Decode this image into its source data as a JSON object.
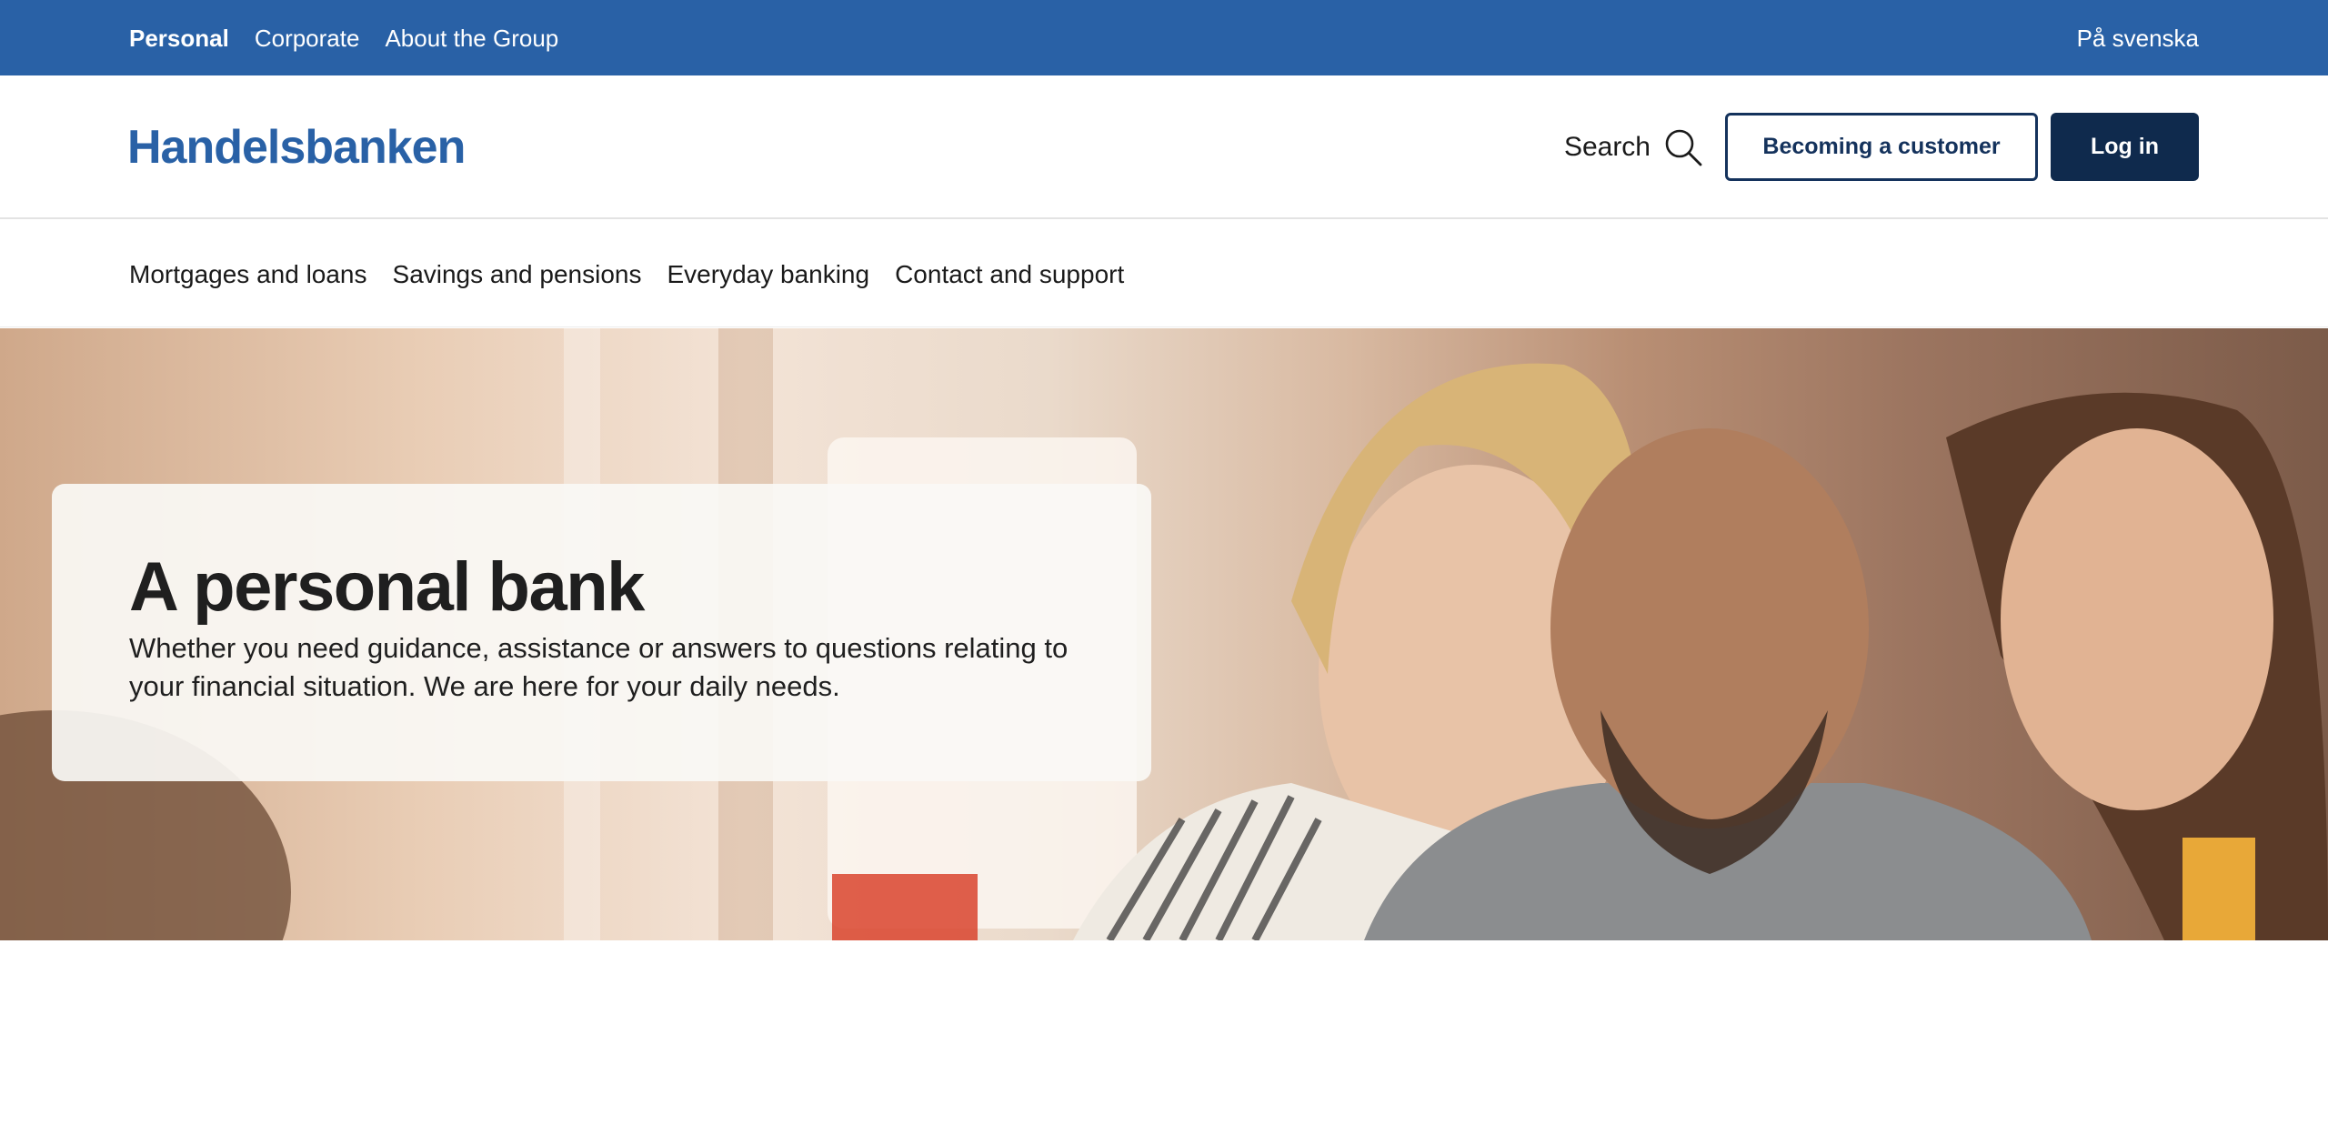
{
  "top_bar": {
    "segments": [
      "Personal",
      "Corporate",
      "About the Group"
    ],
    "active_segment": "Personal",
    "language_link": "På svenska",
    "bg_color": "#2961a6"
  },
  "header": {
    "logo": "Handelsbanken",
    "search_label": "Search",
    "search_icon": "search-icon",
    "becoming_customer_label": "Becoming a customer",
    "login_label": "Log in"
  },
  "main_nav": {
    "items": [
      "Mortgages and loans",
      "Savings and pensions",
      "Everyday banking",
      "Contact and support"
    ]
  },
  "hero": {
    "title": "A personal bank",
    "description": "Whether you need guidance, assistance or answers to questions relating to your financial situation. We are here for your daily needs."
  },
  "colors": {
    "brand_blue": "#2961a6",
    "dark_navy": "#0f2a4d"
  }
}
